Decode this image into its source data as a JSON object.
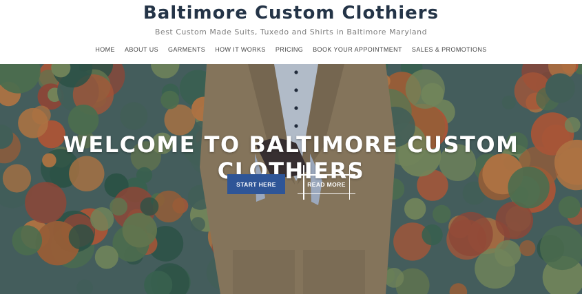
{
  "site": {
    "title": "Baltimore Custom Clothiers",
    "tagline": "Best Custom Made Suits, Tuxedo and Shirts in Baltimore Maryland"
  },
  "nav": {
    "items": [
      {
        "label": "HOME"
      },
      {
        "label": "ABOUT US"
      },
      {
        "label": "GARMENTS"
      },
      {
        "label": "HOW IT WORKS"
      },
      {
        "label": "PRICING"
      },
      {
        "label": "BOOK YOUR APPOINTMENT"
      },
      {
        "label": "SALES & PROMOTIONS"
      }
    ]
  },
  "hero": {
    "title": "WELCOME TO BALTIMORE CUSTOM CLOTHIERS",
    "start_label": "START HERE",
    "read_label": "READ MORE"
  },
  "colors": {
    "title": "#243447",
    "primary_button": "#2e5597",
    "overlay": "#263e5a"
  }
}
